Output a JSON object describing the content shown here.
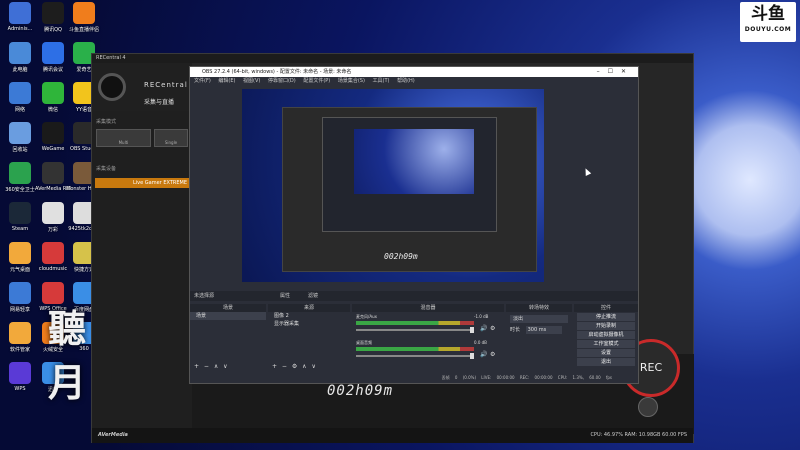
{
  "desktop": {
    "icons": [
      {
        "label": "Adminis...",
        "color": "#3f6fd6"
      },
      {
        "label": "腾讯QQ",
        "color": "#1d1d1d"
      },
      {
        "label": "斗鱼直播伴侣",
        "color": "#f07d1c"
      },
      {
        "label": "此电脑",
        "color": "#4a8ad8"
      },
      {
        "label": "腾讯会议",
        "color": "#2d6fe6"
      },
      {
        "label": "爱奇艺",
        "color": "#2ab04a"
      },
      {
        "label": "网络",
        "color": "#3c7ad6"
      },
      {
        "label": "微信",
        "color": "#2fb53a"
      },
      {
        "label": "YY语音",
        "color": "#f2c41c"
      },
      {
        "label": "回收站",
        "color": "#6a9de0"
      },
      {
        "label": "WeGame",
        "color": "#1a1a1a"
      },
      {
        "label": "OBS Studio",
        "color": "#2a2a2a"
      },
      {
        "label": "360安全卫士",
        "color": "#2ba24e"
      },
      {
        "label": "AVerMedia RECentral 4",
        "color": "#333333"
      },
      {
        "label": "Monster Hunter",
        "color": "#7a5a3a"
      },
      {
        "label": "Steam",
        "color": "#1b2838"
      },
      {
        "label": "万彩",
        "color": "#e0e0e0"
      },
      {
        "label": "9425tk2c3...",
        "color": "#dddddd"
      },
      {
        "label": "元气桌面",
        "color": "#f2a93b"
      },
      {
        "label": "cloudmusic",
        "color": "#d63a3a"
      },
      {
        "label": "快捷方式",
        "color": "#d6c24a"
      },
      {
        "label": "网易轻享",
        "color": "#3c7ad6"
      },
      {
        "label": "WPS Office",
        "color": "#d63a3a"
      },
      {
        "label": "百度网盘",
        "color": "#3a8ee6"
      },
      {
        "label": "软件管家",
        "color": "#f2a93b"
      },
      {
        "label": "火绒安全",
        "color": "#f07d1c"
      },
      {
        "label": "360",
        "color": "#3a8ee6"
      },
      {
        "label": "WPS",
        "color": "#5a3ad6"
      },
      {
        "label": "迅雷",
        "color": "#3a8ee6"
      }
    ],
    "calligraphy": [
      "聽",
      "月"
    ]
  },
  "douyu": {
    "big": "斗鱼",
    "small": "DOUYU.COM"
  },
  "recentral": {
    "title": "RECentral 4",
    "brand": "RECentral",
    "mode": "采集与直播",
    "section_capture_mode": "采集模式",
    "mode_options": [
      "Multi",
      "Single"
    ],
    "section_device": "采集设备",
    "device": "Live Gamer EXTREME",
    "time": "002h09m",
    "rec_label": "REC",
    "footer_brand": "AVerMedia",
    "stats": "CPU: 46.97%  RAM: 10.98GB  60.00 FPS"
  },
  "obs": {
    "title": "OBS 27.2.4 (64-bit, windows) - 配置文件: 未命名 - 场景: 未命名",
    "menu": [
      "文件(F)",
      "编辑(E)",
      "视图(V)",
      "停靠窗口(D)",
      "配置文件(P)",
      "场景集合(S)",
      "工具(T)",
      "帮助(H)"
    ],
    "toolbar_text": "未选择源",
    "toolbar_buttons": [
      "属性",
      "滤镜"
    ],
    "scenes_title": "场景",
    "scenes": [
      "场景"
    ],
    "sources_title": "来源",
    "sources": [
      "图像 2",
      "显示器采集"
    ],
    "mixer_title": "混音器",
    "mixer": [
      {
        "name": "麦克风/Aux",
        "db": "-1.0 dB"
      },
      {
        "name": "桌面音频",
        "db": "0.0 dB"
      }
    ],
    "transitions_title": "转场特效",
    "transition_type": "淡出",
    "duration_label": "时长",
    "duration_value": "300 ms",
    "controls_title": "控件",
    "controls": [
      "停止推流",
      "开始录制",
      "启动虚拟摄像机",
      "工作室模式",
      "设置",
      "退出"
    ],
    "status": "丢帧 0 (0.0%)   LIVE: 00:00:00   REC: 00:00:00   CPU: 1.3%, 60.00 fps",
    "preview_time": "002h09m"
  },
  "colors": {
    "rec_accent": "#c92a2a",
    "device_highlight": "#c8790e",
    "meter_green": "#3aa645"
  }
}
